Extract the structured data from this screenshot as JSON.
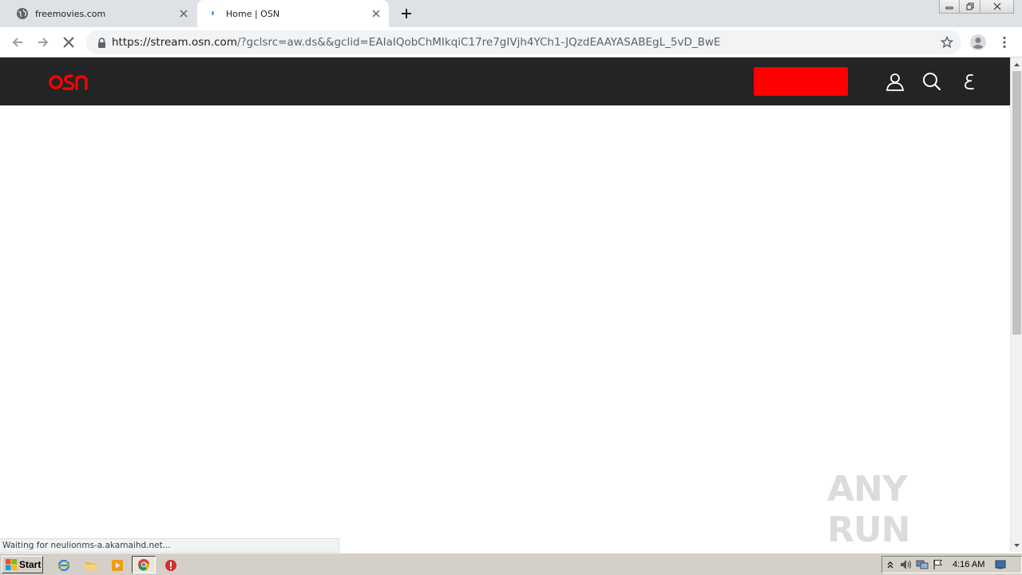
{
  "browser": {
    "tabs": [
      {
        "title": "freemovies.com",
        "active": false,
        "favicon": "globe-icon"
      },
      {
        "title": "Home | OSN",
        "active": true,
        "favicon": "loading-spinner-icon"
      }
    ],
    "address": {
      "host_part": "https://stream.osn.com",
      "path_part": "/?gclsrc=aw.ds&&gclid=EAIaIQobChMIkqiC17re7gIVjh4YCh1-JQzdEAAYASABEgL_5vD_BwE"
    },
    "status_text": "Waiting for neulionms-a.akamaihd.net..."
  },
  "site": {
    "brand_color": "#ff0000",
    "header_color": "#232426",
    "header_icons": [
      "user-icon",
      "search-icon",
      "arabic-language-icon"
    ],
    "language_glyph": "ع"
  },
  "watermark": {
    "text": "ANY RUN"
  },
  "taskbar": {
    "start_label": "Start",
    "clock": "4:16 AM"
  }
}
